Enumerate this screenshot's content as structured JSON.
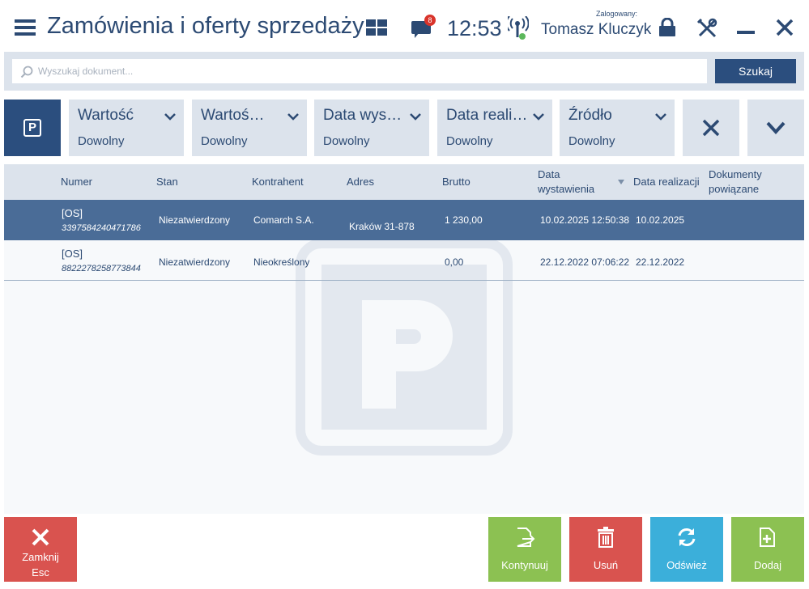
{
  "header": {
    "title": "Zamówienia i oferty sprzedaży",
    "notification_count": "8",
    "time": "12:53",
    "logged_in_label": "Zalogowany:",
    "user_name": "Tomasz Kluczyk"
  },
  "search": {
    "placeholder": "Wyszukaj dokument...",
    "button_label": "Szukaj"
  },
  "filters": [
    {
      "label": "Wartość",
      "value": "Dowolny"
    },
    {
      "label": "Wartoś…",
      "value": "Dowolny"
    },
    {
      "label": "Data wys…",
      "value": "Dowolny"
    },
    {
      "label": "Data reali…",
      "value": "Dowolny"
    },
    {
      "label": "Źródło",
      "value": "Dowolny"
    }
  ],
  "tile_letter": "P",
  "table": {
    "columns": {
      "numer": "Numer",
      "stan": "Stan",
      "kontrahent": "Kontrahent",
      "adres": "Adres",
      "brutto": "Brutto",
      "data_wyst_1": "Data",
      "data_wyst_2": "wystawienia",
      "data_real": "Data realizacji",
      "dok_1": "Dokumenty",
      "dok_2": "powiązane"
    },
    "rows": [
      {
        "type": "[OS]",
        "number": "3397584240471786",
        "state": "Niezatwierdzony",
        "contractor": "Comarch S.A.",
        "address": "Kraków 31-878",
        "gross": "1 230,00",
        "issue_date": "10.02.2025 12:50:38",
        "realization_date": "10.02.2025"
      },
      {
        "type": "[OS]",
        "number": "8822278258773844",
        "state": "Niezatwierdzony",
        "contractor": "Nieokreślony",
        "address": "",
        "gross": "0,00",
        "issue_date": "22.12.2022 07:06:22",
        "realization_date": "22.12.2022"
      }
    ]
  },
  "buttons": {
    "close_line1": "Zamknij",
    "close_line2": "Esc",
    "continue": "Kontynuuj",
    "delete": "Usuń",
    "refresh": "Odśwież",
    "add": "Dodaj"
  },
  "colors": {
    "primary": "#2b4e7e",
    "selected_row": "#4a6c97",
    "close": "#d9534f",
    "delete": "#d9534f",
    "continue": "#8cc152",
    "add": "#8cc152",
    "refresh": "#3bafda"
  }
}
